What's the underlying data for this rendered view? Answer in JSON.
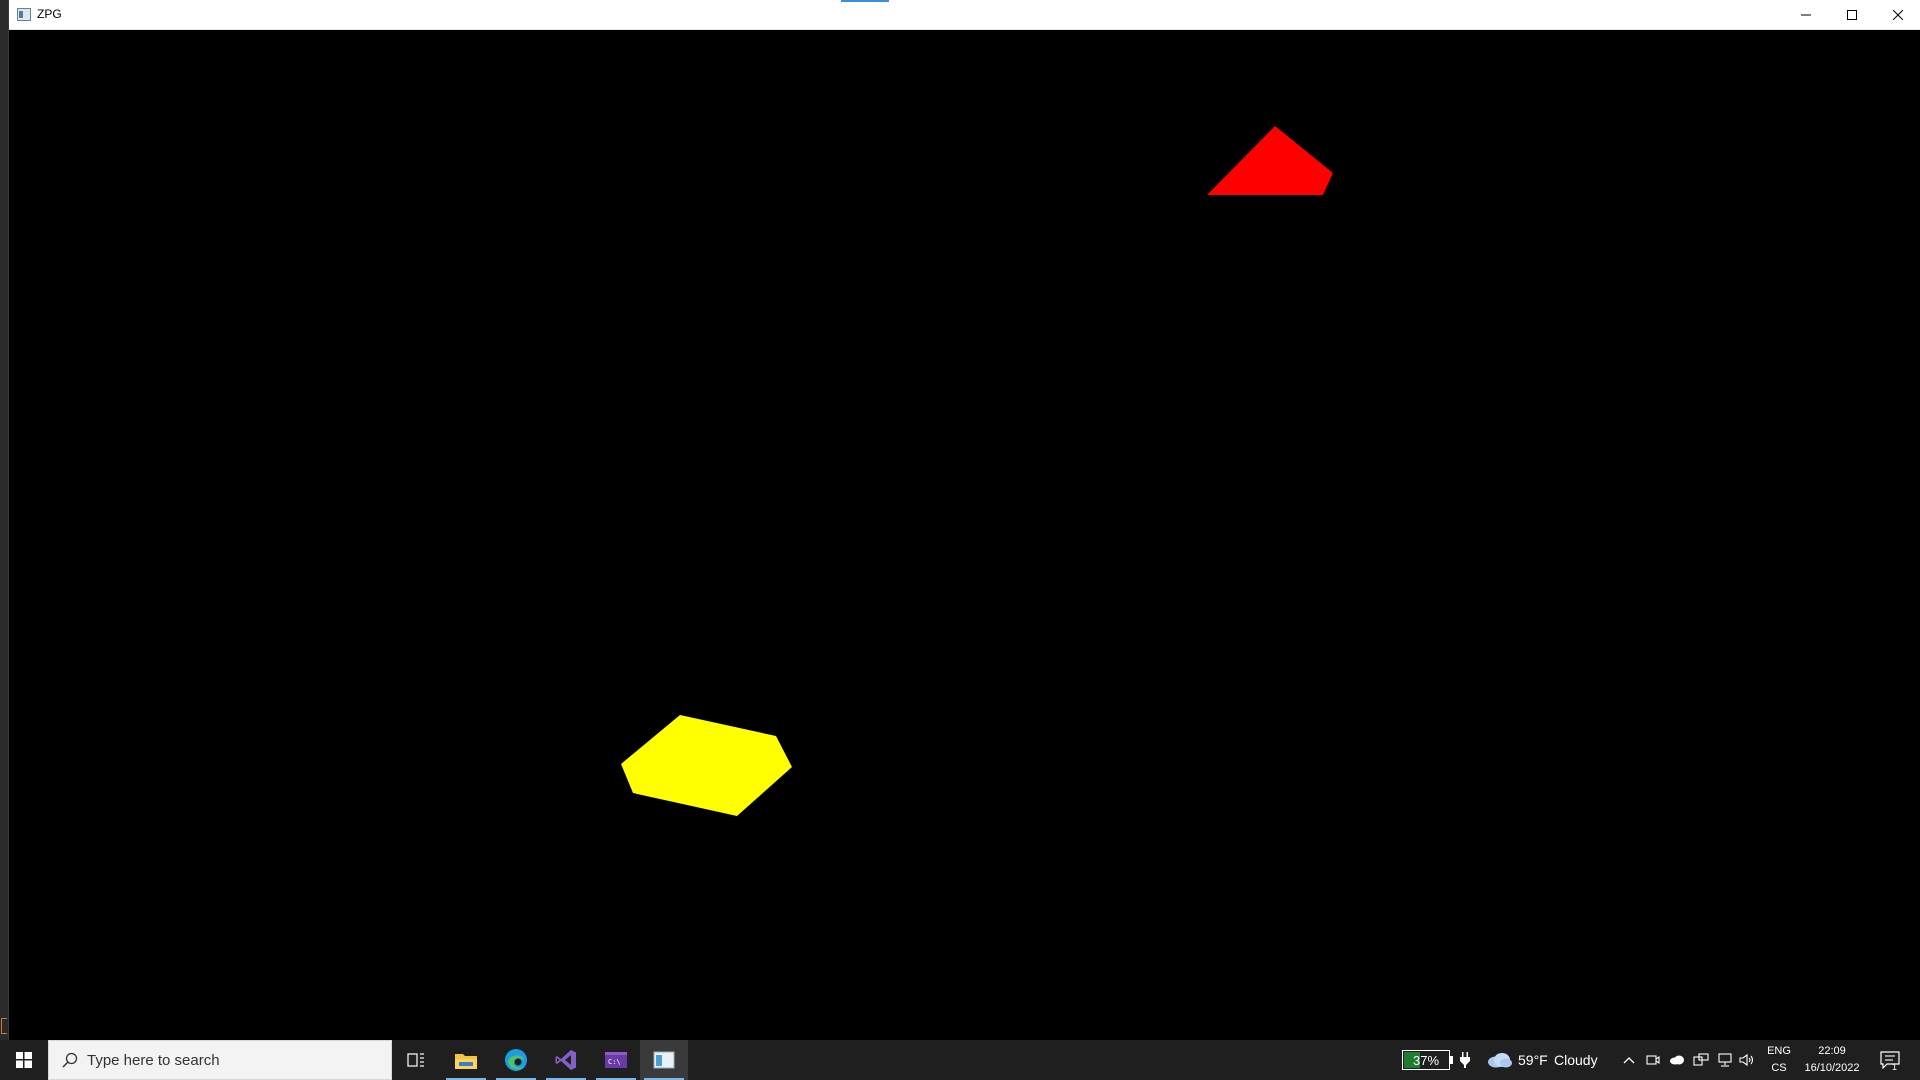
{
  "window": {
    "title": "ZPG"
  },
  "scene": {
    "background": "#000000",
    "shapes": [
      {
        "name": "red-triangle",
        "color": "#ff0000"
      },
      {
        "name": "yellow-hexagon",
        "color": "#ffff00"
      }
    ]
  },
  "taskbar": {
    "search_placeholder": "Type here to search",
    "pinned": [
      {
        "name": "task-view-icon"
      },
      {
        "name": "file-explorer-icon"
      },
      {
        "name": "edge-icon"
      },
      {
        "name": "visual-studio-icon"
      },
      {
        "name": "terminal-icon"
      },
      {
        "name": "zpg-app-icon",
        "active": true
      }
    ],
    "tray": {
      "battery_percent": "37%",
      "battery_level": 0.37,
      "weather_temp": "59°F",
      "weather_desc": "Cloudy",
      "lang_top": "ENG",
      "lang_bottom": "CS",
      "time": "22:09",
      "date": "16/10/2022",
      "notification_count": "1"
    }
  }
}
